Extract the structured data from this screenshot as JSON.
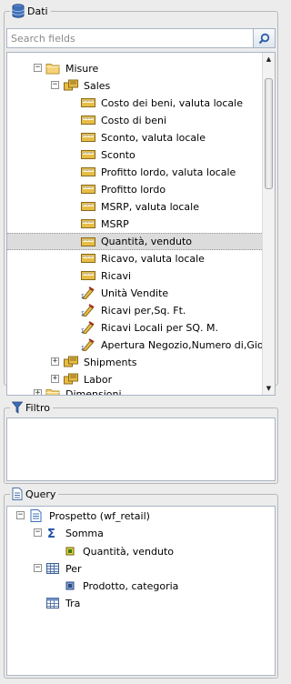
{
  "dati": {
    "title": "Dati",
    "search_placeholder": "Search fields",
    "tree": {
      "misure": "Misure",
      "sales": "Sales",
      "fields": [
        "Costo dei beni, valuta locale",
        "Costo di beni",
        "Sconto, valuta locale",
        "Sconto",
        "Profitto lordo, valuta locale",
        "Profitto lordo",
        "MSRP, valuta locale",
        "MSRP",
        "Quantità, venduto",
        "Ricavo, valuta locale",
        "Ricavi"
      ],
      "computed": [
        "Unità Vendite",
        "Ricavi per,Sq. Ft.",
        "Ricavi Locali per SQ. M.",
        "Apertura Negozio,Numero di,Giorni Ap"
      ],
      "shipments": "Shipments",
      "labor": "Labor",
      "partial": "Dimensioni"
    },
    "selected_field": "Quantità, venduto"
  },
  "filtro": {
    "title": "Filtro"
  },
  "query": {
    "title": "Query",
    "root": "Prospetto (wf_retail)",
    "somma": "Somma",
    "somma_item": "Quantità, venduto",
    "per": "Per",
    "per_item": "Prodotto, categoria",
    "tra": "Tra"
  },
  "colors": {
    "accent_blue": "#2f5fa8",
    "folder_yellow": "#f2c34e",
    "measure_gold": "#e3b23c",
    "selection": "#dcdcdc"
  }
}
